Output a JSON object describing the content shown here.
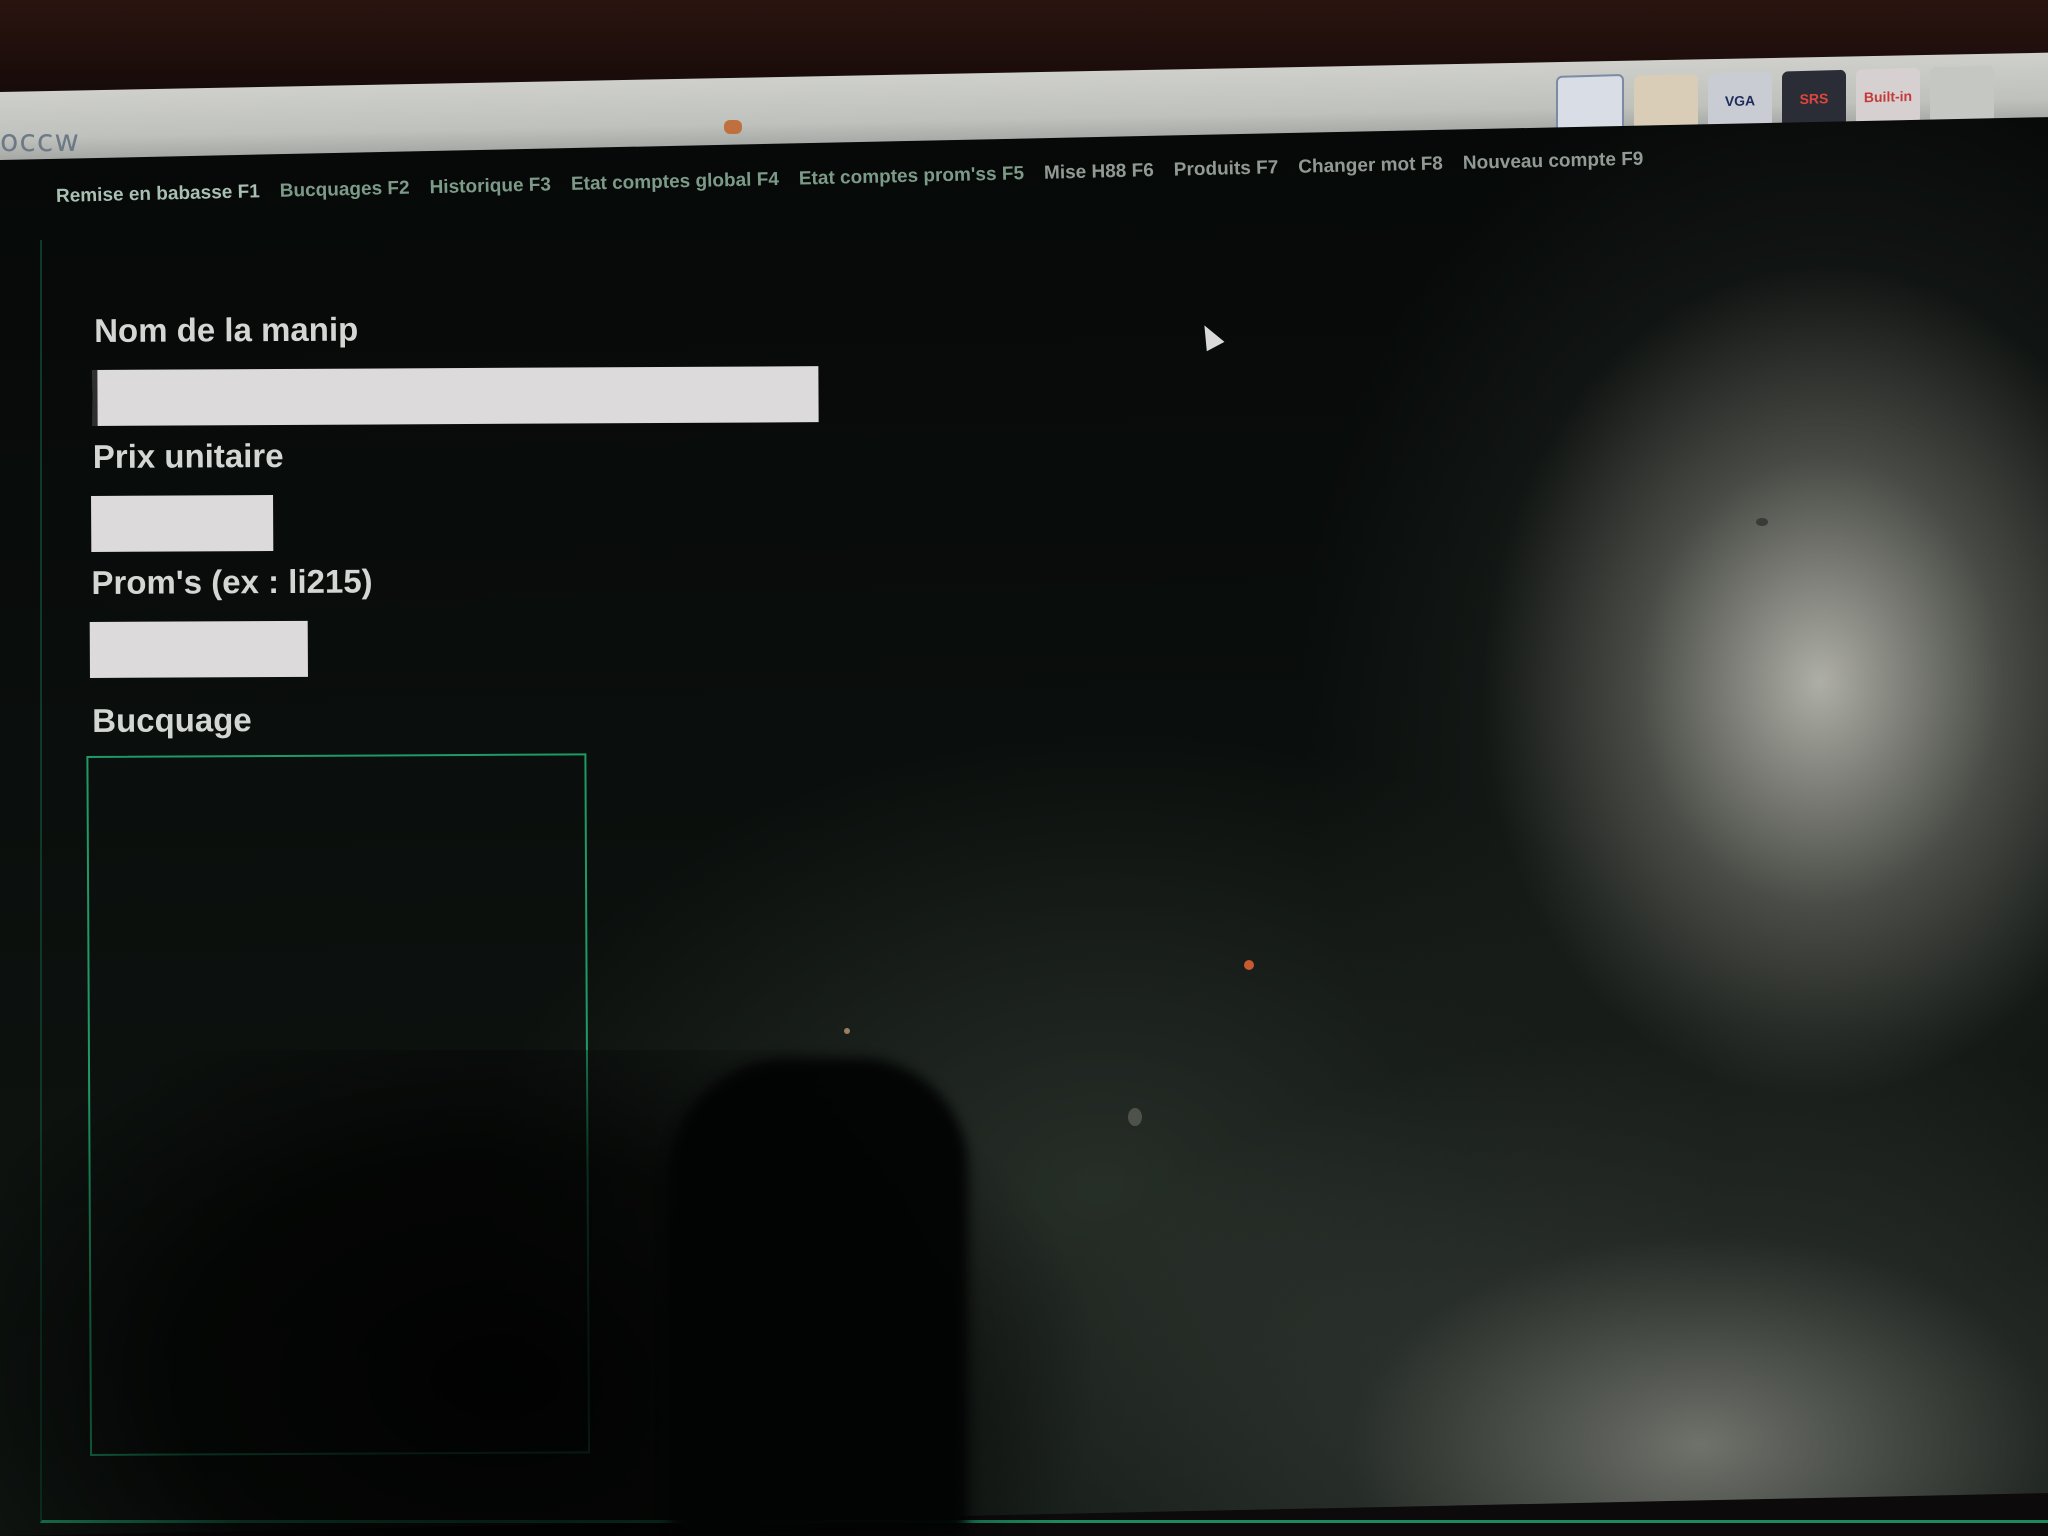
{
  "top_bar": {
    "logo_text": "occw",
    "tray_icons": [
      {
        "name": "network-icon",
        "label": ""
      },
      {
        "name": "laptop-icon",
        "label": ""
      },
      {
        "name": "vga-icon",
        "label": "VGA"
      },
      {
        "name": "srs-icon",
        "label": "SRS"
      },
      {
        "name": "built-in-icon",
        "label": "Built-in"
      },
      {
        "name": "tools-icon",
        "label": ""
      }
    ]
  },
  "nav": {
    "items": [
      {
        "label": "Remise en babasse F1"
      },
      {
        "label": "Bucquages F2"
      },
      {
        "label": "Historique F3"
      },
      {
        "label": "Etat comptes global F4"
      },
      {
        "label": "Etat comptes prom'ss F5"
      },
      {
        "label": "Mise H88 F6"
      },
      {
        "label": "Produits F7"
      },
      {
        "label": "Changer mot F8"
      },
      {
        "label": "Nouveau compte F9"
      }
    ]
  },
  "form": {
    "name_label": "Nom de la manip",
    "name_value": "",
    "price_label": "Prix unitaire",
    "price_value": "",
    "proms_label": "Prom's (ex : li215)",
    "proms_value": "",
    "bucquage_label": "Bucquage",
    "bucquage_value": ""
  },
  "colors": {
    "accent_green": "#1f9a66",
    "input_bg": "#dcdada",
    "label_text": "#d3d6d2",
    "nav_text": "#7c9a88",
    "screen_bg": "#060908"
  }
}
